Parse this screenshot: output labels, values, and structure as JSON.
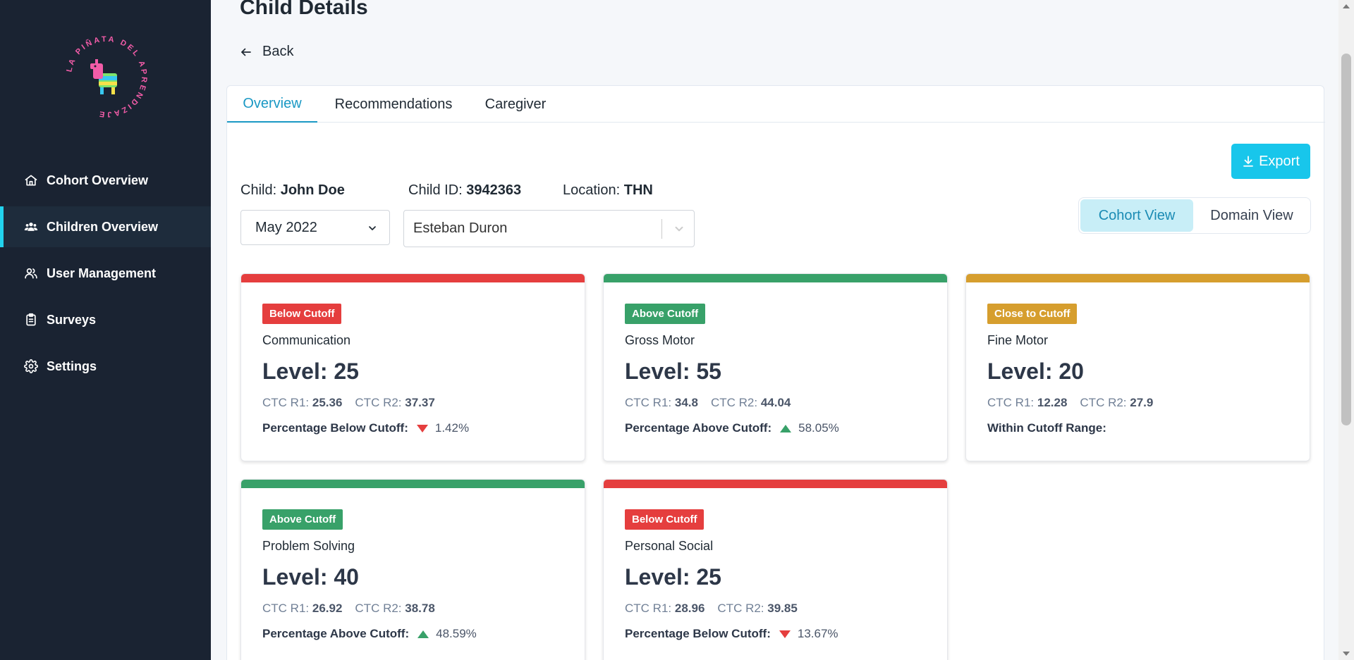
{
  "sidebar": {
    "logo_text": "LA PIÑATA DEL APRENDIZAJE",
    "items": [
      {
        "label": "Cohort Overview",
        "icon": "home-icon",
        "active": false
      },
      {
        "label": "Children Overview",
        "icon": "users-icon",
        "active": true
      },
      {
        "label": "User Management",
        "icon": "user-group-icon",
        "active": false
      },
      {
        "label": "Surveys",
        "icon": "clipboard-icon",
        "active": false
      },
      {
        "label": "Settings",
        "icon": "gear-icon",
        "active": false
      }
    ]
  },
  "header": {
    "title": "Child Details",
    "back_label": "Back"
  },
  "tabs": [
    {
      "label": "Overview",
      "active": true
    },
    {
      "label": "Recommendations",
      "active": false
    },
    {
      "label": "Caregiver",
      "active": false
    }
  ],
  "export_label": "Export",
  "info": {
    "child_label": "Child:",
    "child_value": "John Doe",
    "id_label": "Child ID:",
    "id_value": "3942363",
    "location_label": "Location:",
    "location_value": "THN"
  },
  "filters": {
    "date_value": "May 2022",
    "caregiver_value": "Esteban Duron"
  },
  "view_toggle": {
    "cohort_label": "Cohort View",
    "domain_label": "Domain View",
    "active": "cohort"
  },
  "colors": {
    "below": "#e53e3e",
    "above": "#38a169",
    "close": "#d69e2e",
    "accent": "#18c6eb",
    "sidebar_bg": "#1a2332"
  },
  "cards": [
    {
      "status": "Below Cutoff",
      "status_color": "#e53e3e",
      "domain": "Communication",
      "level": "Level: 25",
      "r1_label": "CTC R1:",
      "r1": "25.36",
      "r2_label": "CTC R2:",
      "r2": "37.37",
      "pct_label": "Percentage Below Cutoff:",
      "trend": "down",
      "pct": "1.42%"
    },
    {
      "status": "Above Cutoff",
      "status_color": "#38a169",
      "domain": "Gross Motor",
      "level": "Level: 55",
      "r1_label": "CTC R1:",
      "r1": "34.8",
      "r2_label": "CTC R2:",
      "r2": "44.04",
      "pct_label": "Percentage Above Cutoff:",
      "trend": "up",
      "pct": "58.05%"
    },
    {
      "status": "Close to Cutoff",
      "status_color": "#d69e2e",
      "domain": "Fine Motor",
      "level": "Level: 20",
      "r1_label": "CTC R1:",
      "r1": "12.28",
      "r2_label": "CTC R2:",
      "r2": "27.9",
      "pct_label": "Within Cutoff Range:",
      "trend": "none",
      "pct": ""
    },
    {
      "status": "Above Cutoff",
      "status_color": "#38a169",
      "domain": "Problem Solving",
      "level": "Level: 40",
      "r1_label": "CTC R1:",
      "r1": "26.92",
      "r2_label": "CTC R2:",
      "r2": "38.78",
      "pct_label": "Percentage Above Cutoff:",
      "trend": "up",
      "pct": "48.59%"
    },
    {
      "status": "Below Cutoff",
      "status_color": "#e53e3e",
      "domain": "Personal Social",
      "level": "Level: 25",
      "r1_label": "CTC R1:",
      "r1": "28.96",
      "r2_label": "CTC R2:",
      "r2": "39.85",
      "pct_label": "Percentage Below Cutoff:",
      "trend": "down",
      "pct": "13.67%"
    }
  ]
}
